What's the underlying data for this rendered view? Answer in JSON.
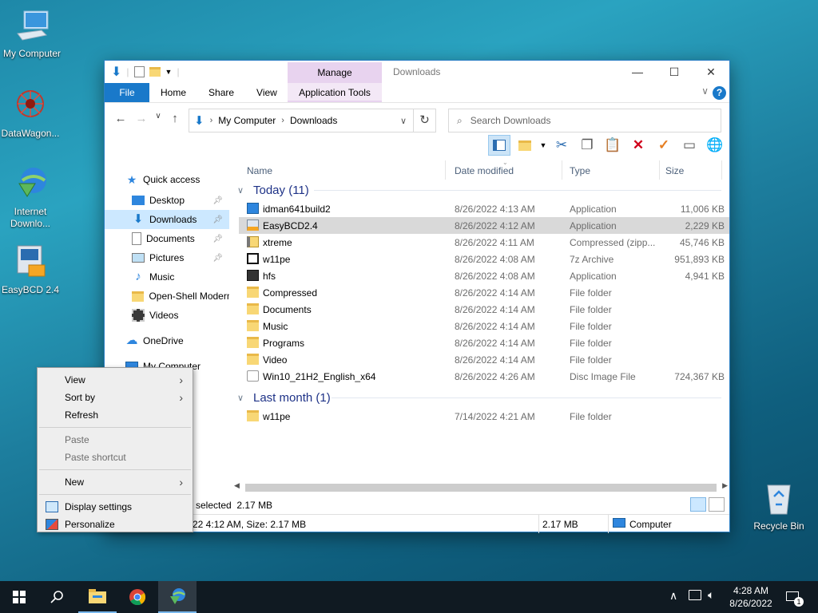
{
  "desktop": {
    "icons": [
      {
        "label": "My Computer",
        "icon": "monitor-icon"
      },
      {
        "label": "DataWagon...",
        "icon": "datawagon-icon"
      },
      {
        "label": "Internet Downlo...",
        "icon": "idm-icon"
      },
      {
        "label": "EasyBCD 2.4",
        "icon": "easybcd-icon"
      },
      {
        "label": "Recycle Bin",
        "icon": "recycle-bin-icon"
      }
    ]
  },
  "window": {
    "title": "Downloads",
    "manage_tab": "Manage",
    "controls": [
      "—",
      "☐",
      "✕"
    ]
  },
  "ribbon": {
    "tabs": [
      "File",
      "Home",
      "Share",
      "View"
    ],
    "contextual_tab": "Application Tools"
  },
  "address": {
    "path": [
      "My Computer",
      "Downloads"
    ]
  },
  "search": {
    "placeholder": "Search Downloads"
  },
  "nav_pane": {
    "items": [
      {
        "label": "Quick access",
        "icon": "star-icon",
        "pinned": false
      },
      {
        "label": "Desktop",
        "icon": "desktop-folder-icon",
        "pinned": true
      },
      {
        "label": "Downloads",
        "icon": "download-arrow-icon",
        "pinned": true,
        "selected": true
      },
      {
        "label": "Documents",
        "icon": "document-icon",
        "pinned": true
      },
      {
        "label": "Pictures",
        "icon": "pictures-icon",
        "pinned": true
      },
      {
        "label": "Music",
        "icon": "music-note-icon",
        "pinned": false
      },
      {
        "label": "Open-Shell Modern",
        "icon": "folder-icon",
        "pinned": false
      },
      {
        "label": "Videos",
        "icon": "film-icon",
        "pinned": false
      },
      {
        "label": "OneDrive",
        "icon": "cloud-icon",
        "pinned": false
      },
      {
        "label": "My Computer",
        "icon": "computer-icon",
        "pinned": false
      }
    ]
  },
  "columns": [
    "Name",
    "Date modified",
    "Type",
    "Size"
  ],
  "groups": [
    {
      "title": "Today (11)",
      "rows": [
        {
          "name": "idman641build2",
          "date": "8/26/2022 4:13 AM",
          "type": "Application",
          "size": "11,006 KB",
          "icon": "idm-app-icon"
        },
        {
          "name": "EasyBCD2.4",
          "date": "8/26/2022 4:12 AM",
          "type": "Application",
          "size": "2,229 KB",
          "icon": "easybcd-app-icon",
          "selected": true
        },
        {
          "name": "xtreme",
          "date": "8/26/2022 4:11 AM",
          "type": "Compressed (zipp...",
          "size": "45,746 KB",
          "icon": "zip-icon"
        },
        {
          "name": "w11pe",
          "date": "8/26/2022 4:08 AM",
          "type": "7z Archive",
          "size": "951,893 KB",
          "icon": "7z-icon"
        },
        {
          "name": "hfs",
          "date": "8/26/2022 4:08 AM",
          "type": "Application",
          "size": "4,941 KB",
          "icon": "hfs-app-icon"
        },
        {
          "name": "Compressed",
          "date": "8/26/2022 4:14 AM",
          "type": "File folder",
          "size": "",
          "icon": "folder-icon"
        },
        {
          "name": "Documents",
          "date": "8/26/2022 4:14 AM",
          "type": "File folder",
          "size": "",
          "icon": "folder-icon"
        },
        {
          "name": "Music",
          "date": "8/26/2022 4:14 AM",
          "type": "File folder",
          "size": "",
          "icon": "folder-icon"
        },
        {
          "name": "Programs",
          "date": "8/26/2022 4:14 AM",
          "type": "File folder",
          "size": "",
          "icon": "folder-icon"
        },
        {
          "name": "Video",
          "date": "8/26/2022 4:14 AM",
          "type": "File folder",
          "size": "",
          "icon": "folder-icon"
        },
        {
          "name": "Win10_21H2_English_x64",
          "date": "8/26/2022 4:26 AM",
          "type": "Disc Image File",
          "size": "724,367 KB",
          "icon": "disc-image-icon"
        }
      ]
    },
    {
      "title": "Last month (1)",
      "rows": [
        {
          "name": "w11pe",
          "date": "7/14/2022 4:21 AM",
          "type": "File folder",
          "size": "",
          "icon": "folder-icon"
        }
      ]
    }
  ],
  "status": {
    "selected": "selected",
    "selected_size": "2.17 MB",
    "details": "22 4:12 AM, Size: 2.17 MB",
    "size": "2.17 MB",
    "location": "Computer"
  },
  "context_menu": {
    "items": [
      {
        "label": "View",
        "submenu": true,
        "disabled": false
      },
      {
        "label": "Sort by",
        "submenu": true,
        "disabled": false
      },
      {
        "label": "Refresh",
        "submenu": false,
        "disabled": false
      },
      {
        "sep": true
      },
      {
        "label": "Paste",
        "submenu": false,
        "disabled": true
      },
      {
        "label": "Paste shortcut",
        "submenu": false,
        "disabled": true
      },
      {
        "sep": true
      },
      {
        "label": "New",
        "submenu": true,
        "disabled": false
      },
      {
        "sep": true
      },
      {
        "label": "Display settings",
        "submenu": false,
        "disabled": false,
        "icon": "display-icon"
      },
      {
        "label": "Personalize",
        "submenu": false,
        "disabled": false,
        "icon": "personalize-icon"
      }
    ]
  },
  "taskbar": {
    "apps": [
      "start-icon",
      "search-icon",
      "file-explorer-icon",
      "chrome-icon",
      "idm-icon"
    ],
    "time": "4:28 AM",
    "date": "8/26/2022",
    "notification_count": "1"
  },
  "colors": {
    "accent": "#1979ca",
    "selection": "#cce8ff",
    "manage_tab": "#e8d3ef"
  }
}
